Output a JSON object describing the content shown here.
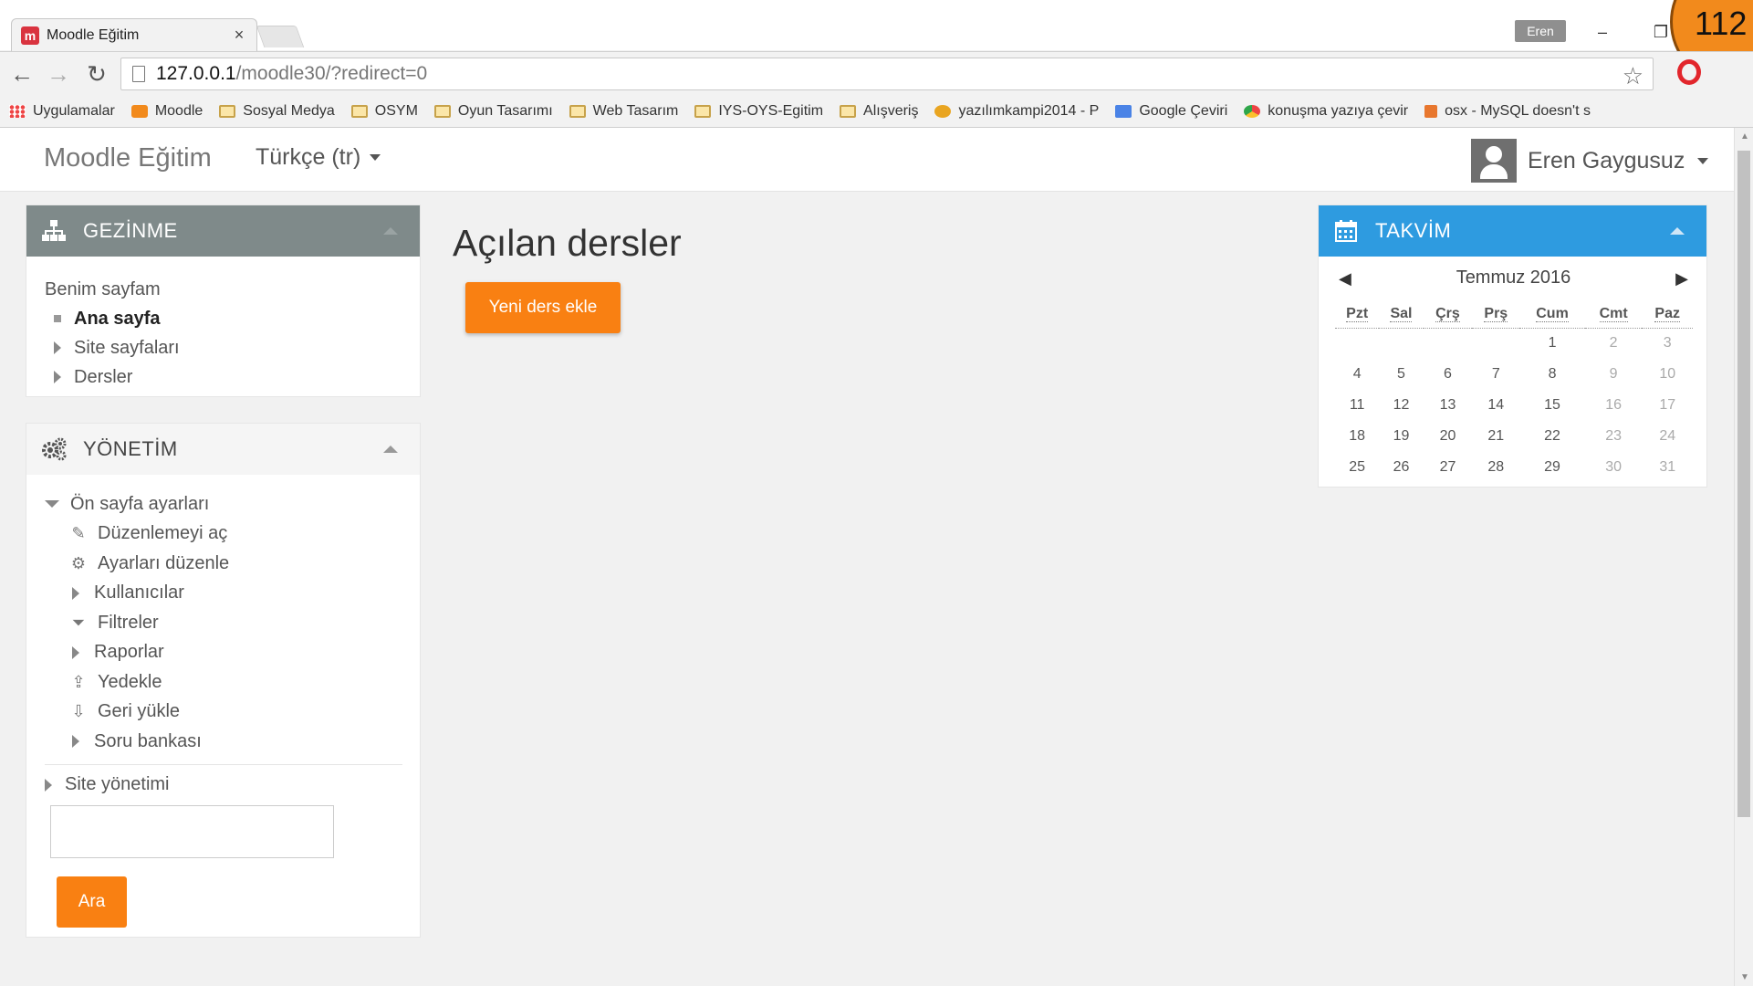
{
  "browser": {
    "tab_title": "Moodle Eğitim",
    "tab_close": "×",
    "profile": "Eren",
    "badge": "112",
    "url_host": "127.0.0.1",
    "url_path": "/moodle30/?redirect=0",
    "bookmarks": [
      {
        "label": "Uygulamalar",
        "icon": "apps-icon"
      },
      {
        "label": "Moodle",
        "icon": "moodle-icon"
      },
      {
        "label": "Sosyal Medya",
        "icon": "folder-icon"
      },
      {
        "label": "OSYM",
        "icon": "folder-icon"
      },
      {
        "label": "Oyun Tasarımı",
        "icon": "folder-icon"
      },
      {
        "label": "Web Tasarım",
        "icon": "folder-icon"
      },
      {
        "label": "IYS-OYS-Egitim",
        "icon": "folder-icon"
      },
      {
        "label": "Alışveriş",
        "icon": "folder-icon"
      },
      {
        "label": "yazılımkampi2014 - P",
        "icon": "tiger-icon"
      },
      {
        "label": "Google Çeviri",
        "icon": "google-translate-icon"
      },
      {
        "label": "konuşma yazıya çevir",
        "icon": "chrome-icon"
      },
      {
        "label": "osx - MySQL doesn't s",
        "icon": "java-icon"
      }
    ]
  },
  "navbar": {
    "brand": "Moodle Eğitim",
    "language": "Türkçe (tr)",
    "user_name": "Eren Gaygusuz"
  },
  "navigation": {
    "title": "GEZİNME",
    "my_page": "Benim sayfam",
    "home": "Ana sayfa",
    "site_pages": "Site sayfaları",
    "courses": "Dersler"
  },
  "administration": {
    "title": "YÖNETİM",
    "front_page_settings": "Ön sayfa ayarları",
    "items": [
      {
        "label": "Düzenlemeyi aç",
        "icon": "pencil-icon",
        "expandable": false
      },
      {
        "label": "Ayarları düzenle",
        "icon": "gear-icon",
        "expandable": false
      },
      {
        "label": "Kullanıcılar",
        "icon": "",
        "expandable": true
      },
      {
        "label": "Filtreler",
        "icon": "filter-icon",
        "expandable": false
      },
      {
        "label": "Raporlar",
        "icon": "",
        "expandable": true
      },
      {
        "label": "Yedekle",
        "icon": "backup-icon",
        "expandable": false
      },
      {
        "label": "Geri yükle",
        "icon": "restore-icon",
        "expandable": false
      },
      {
        "label": "Soru bankası",
        "icon": "",
        "expandable": true
      }
    ],
    "site_admin": "Site yönetimi",
    "search_value": "",
    "search_button": "Ara"
  },
  "main": {
    "title": "Açılan dersler",
    "add_course": "Yeni ders ekle"
  },
  "calendar": {
    "title": "TAKVİM",
    "month": "Temmuz 2016",
    "prev": "◀",
    "next": "▶",
    "weekdays": [
      "Pzt",
      "Sal",
      "Çrş",
      "Prş",
      "Cum",
      "Cmt",
      "Paz"
    ],
    "weeks": [
      [
        "",
        "",
        "",
        "",
        "1",
        "2",
        "3"
      ],
      [
        "4",
        "5",
        "6",
        "7",
        "8",
        "9",
        "10"
      ],
      [
        "11",
        "12",
        "13",
        "14",
        "15",
        "16",
        "17"
      ],
      [
        "18",
        "19",
        "20",
        "21",
        "22",
        "23",
        "24"
      ],
      [
        "25",
        "26",
        "27",
        "28",
        "29",
        "30",
        "31"
      ]
    ]
  },
  "colors": {
    "accent_orange": "#f98012",
    "calendar_blue": "#2e9be0",
    "nav_header_gray": "#7f8a8a"
  }
}
